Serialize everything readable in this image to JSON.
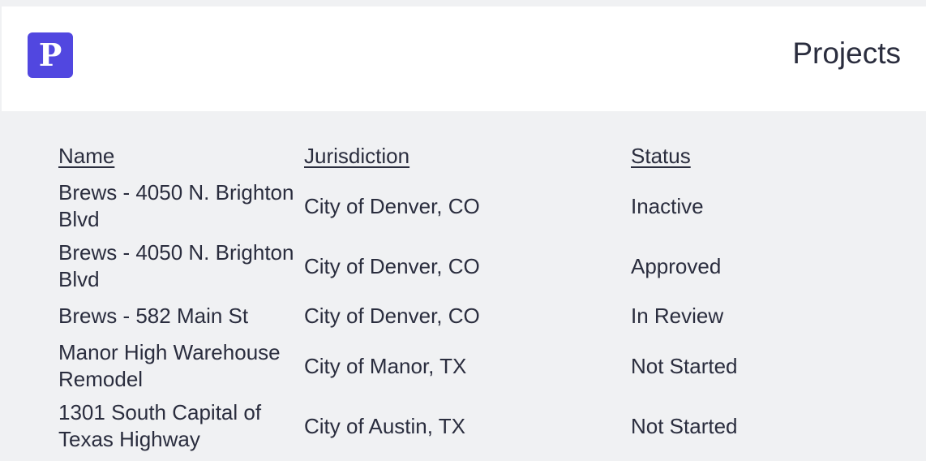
{
  "header": {
    "logo_letter": "P",
    "title": "Projects"
  },
  "table": {
    "columns": [
      "Name",
      "Jurisdiction",
      "Status"
    ],
    "rows": [
      {
        "name": "Brews - 4050 N. Brighton Blvd",
        "jurisdiction": "City of Denver, CO",
        "status": "Inactive"
      },
      {
        "name": "Brews - 4050 N. Brighton Blvd",
        "jurisdiction": "City of Denver, CO",
        "status": "Approved"
      },
      {
        "name": "Brews - 582 Main St",
        "jurisdiction": "City of Denver, CO",
        "status": "In Review"
      },
      {
        "name": "Manor High Warehouse Remodel",
        "jurisdiction": "City of Manor, TX",
        "status": "Not Started"
      },
      {
        "name": "1301 South Capital of Texas Highway",
        "jurisdiction": "City of Austin, TX",
        "status": "Not Started"
      }
    ]
  },
  "colors": {
    "brand": "#5147e0",
    "background": "#f0f1f3",
    "header_background": "#ffffff",
    "text": "#2a2d3e"
  }
}
